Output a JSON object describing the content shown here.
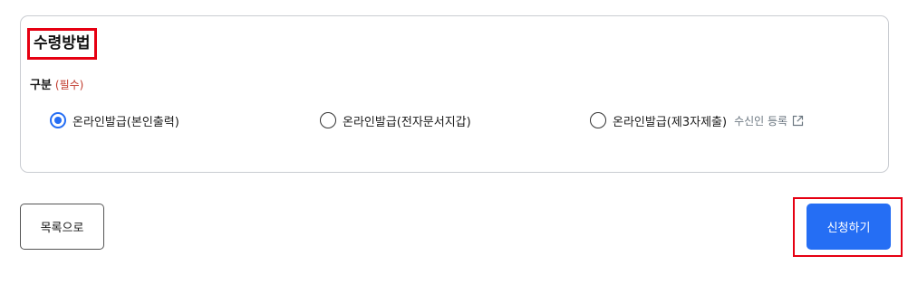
{
  "section": {
    "title": "수령방법"
  },
  "field": {
    "label": "구분",
    "required": "(필수)"
  },
  "options": [
    {
      "label": "온라인발급(본인출력)",
      "checked": true
    },
    {
      "label": "온라인발급(전자문서지갑)",
      "checked": false
    },
    {
      "label": "온라인발급(제3자제출)",
      "checked": false
    }
  ],
  "recipient_link": {
    "label": "수신인 등록",
    "icon": "external-link-icon"
  },
  "buttons": {
    "list": "목록으로",
    "submit": "신청하기"
  },
  "colors": {
    "accent": "#256ef4",
    "highlight": "#e60012",
    "required": "#c0392b"
  }
}
